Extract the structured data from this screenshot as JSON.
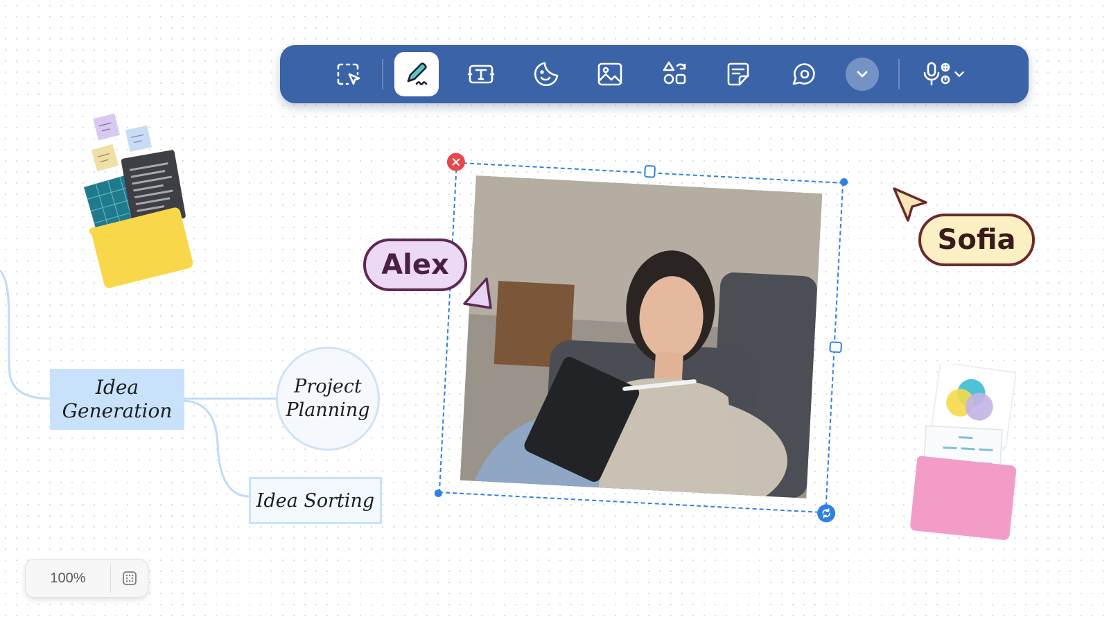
{
  "toolbar": {
    "tools": [
      {
        "name": "select-tool",
        "icon": "select-cursor-icon"
      },
      {
        "name": "pen-tool",
        "icon": "pen-icon",
        "active": true
      },
      {
        "name": "text-tool",
        "icon": "text-box-icon"
      },
      {
        "name": "sticker-tool",
        "icon": "sticker-smile-icon"
      },
      {
        "name": "image-tool",
        "icon": "image-icon"
      },
      {
        "name": "shapes-tool",
        "icon": "shapes-icon"
      },
      {
        "name": "sticky-note-tool",
        "icon": "sticky-note-icon"
      },
      {
        "name": "comment-tool",
        "icon": "comment-icon"
      },
      {
        "name": "more-tools",
        "icon": "chevron-down-icon"
      },
      {
        "name": "record-tool",
        "icon": "microphone-icon"
      }
    ],
    "colors": {
      "background": "#3b63a8",
      "active_bg": "#ffffff",
      "icon": "#ffffff"
    }
  },
  "collaborators": {
    "alex": {
      "label": "Alex",
      "color": "#ecd9f5",
      "border": "#5e2a52"
    },
    "sofia": {
      "label": "Sofia",
      "color": "#fbefc4",
      "border": "#6b2a2a"
    }
  },
  "mind_map": {
    "root": "Idea Generation",
    "root_lines": [
      "Idea",
      "Generation"
    ],
    "children": [
      {
        "label": "Project Planning",
        "lines": [
          "Project",
          "Planning"
        ]
      },
      {
        "label": "Idea Sorting"
      }
    ]
  },
  "zoom": {
    "value": "100%",
    "fit_icon": "fit-to-screen-icon"
  },
  "selection": {
    "accent": "#2f80e0",
    "close_color": "#e5484d"
  }
}
